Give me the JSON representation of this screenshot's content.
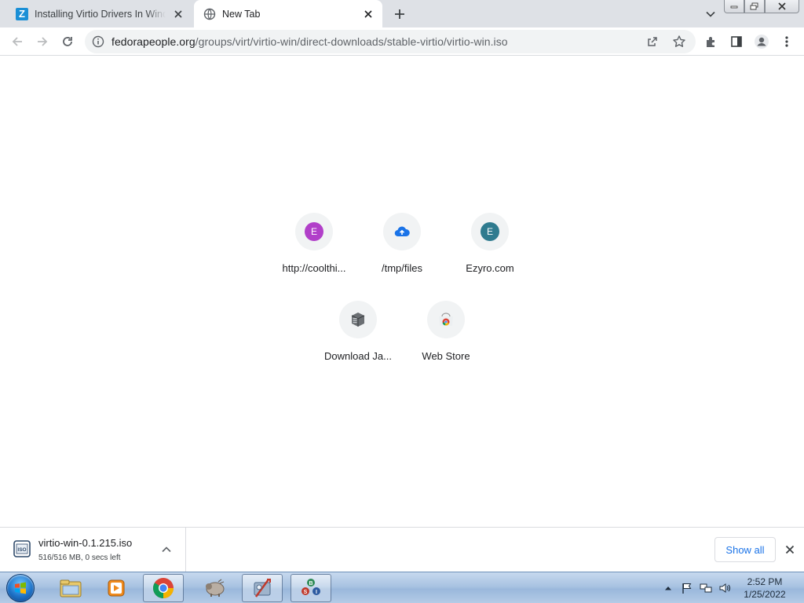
{
  "tabs": [
    {
      "title": "Installing Virtio Drivers In Windo",
      "favicon": "zimbra-z-icon",
      "favicon_letter": "Z",
      "active": false
    },
    {
      "title": "New Tab",
      "favicon": "globe-icon",
      "active": true
    }
  ],
  "toolbar": {
    "url_domain": "fedorapeople.org",
    "url_path": "/groups/virt/virtio-win/direct-downloads/stable-virtio/virtio-win.iso"
  },
  "shortcuts": [
    {
      "label": "http://coolthi...",
      "icon": "letter-avatar",
      "letter": "E",
      "color": "#b13fc9"
    },
    {
      "label": "/tmp/files",
      "icon": "cloud-upload-icon",
      "color": "#1a73e8"
    },
    {
      "label": "Ezyro.com",
      "icon": "letter-avatar",
      "letter": "E",
      "color": "#2f7b8f"
    },
    {
      "label": "Download Ja...",
      "icon": "server-box-icon"
    },
    {
      "label": "Web Store",
      "icon": "chrome-webstore-icon"
    }
  ],
  "download": {
    "filename": "virtio-win-0.1.215.iso",
    "status": "516/516 MB, 0 secs left",
    "icon_text": "ISO"
  },
  "shelf": {
    "show_all_label": "Show all"
  },
  "clock": {
    "time": "2:52 PM",
    "date": "1/25/2022"
  },
  "colors": {
    "accent": "#1a73e8",
    "tabstrip": "#dee1e6",
    "omnibox": "#f1f3f4"
  }
}
